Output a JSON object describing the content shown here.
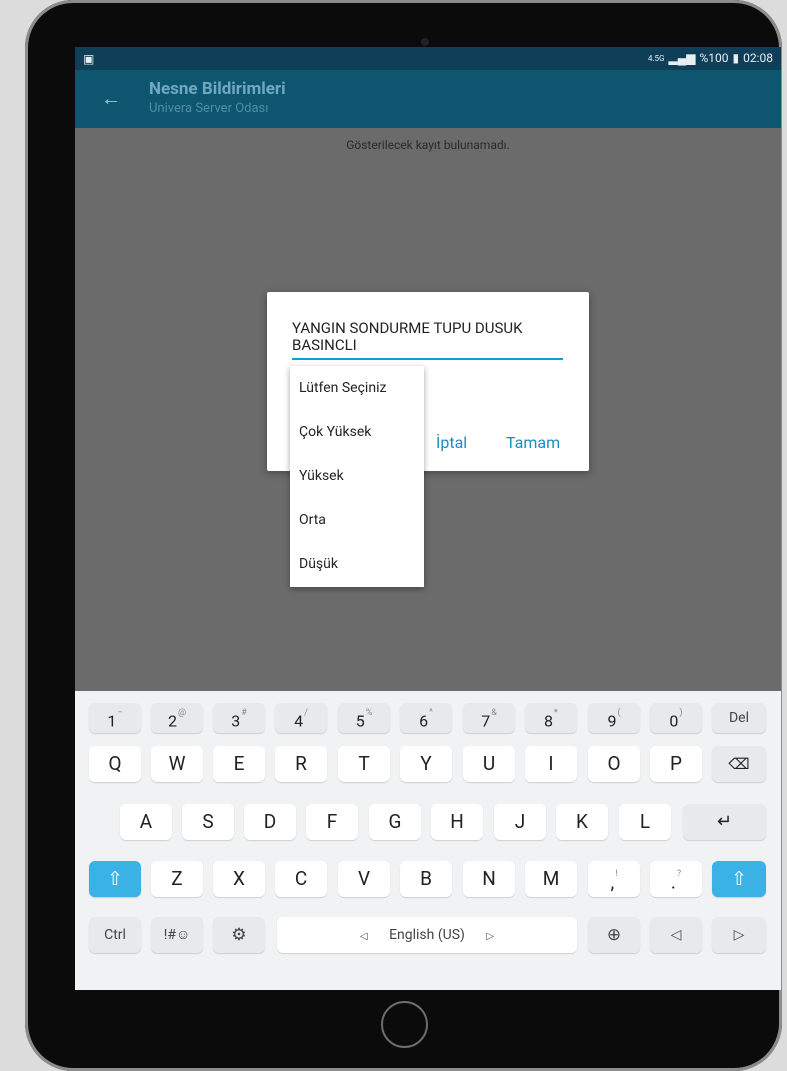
{
  "status": {
    "left_icon": "image-icon",
    "network": "4.5G",
    "signal": "signal-icon",
    "battery_text": "%100",
    "battery_icon": "battery-icon",
    "time": "02:08"
  },
  "toolbar": {
    "title": "Nesne Bildirimleri",
    "subtitle": "Univera Server Odası"
  },
  "main": {
    "empty_message": "Gösterilecek kayıt bulunamadı."
  },
  "dialog": {
    "description": "YANGIN SONDURME TUPU DUSUK BASINCLI",
    "cancel": "İptal",
    "ok": "Tamam"
  },
  "dropdown": {
    "options": [
      "Lütfen Seçiniz",
      "Çok Yüksek",
      "Yüksek",
      "Orta",
      "Düşük"
    ]
  },
  "keyboard": {
    "row1": [
      {
        "k": "1",
        "s": "−"
      },
      {
        "k": "2",
        "s": "@"
      },
      {
        "k": "3",
        "s": "#"
      },
      {
        "k": "4",
        "s": "/"
      },
      {
        "k": "5",
        "s": "%"
      },
      {
        "k": "6",
        "s": "^"
      },
      {
        "k": "7",
        "s": "&"
      },
      {
        "k": "8",
        "s": "*"
      },
      {
        "k": "9",
        "s": "("
      },
      {
        "k": "0",
        "s": ")"
      }
    ],
    "del": "Del",
    "row2": [
      "Q",
      "W",
      "E",
      "R",
      "T",
      "Y",
      "U",
      "I",
      "O",
      "P"
    ],
    "row3": [
      "A",
      "S",
      "D",
      "F",
      "G",
      "H",
      "J",
      "K",
      "L"
    ],
    "row4": [
      "Z",
      "X",
      "C",
      "V",
      "B",
      "N",
      "M"
    ],
    "comma": ",",
    "comma_alt": "!",
    "period": ".",
    "period_alt": "?",
    "ctrl": "Ctrl",
    "sym": "!#☺",
    "space": "English (US)"
  }
}
